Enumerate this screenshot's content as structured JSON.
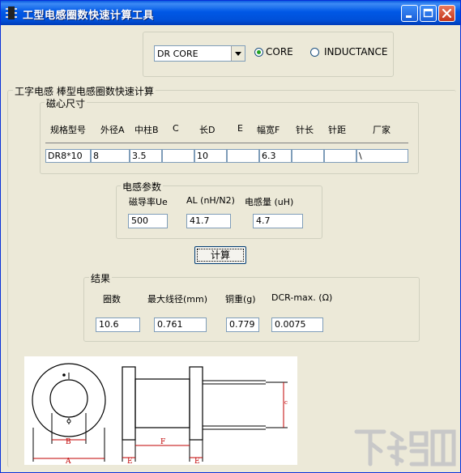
{
  "window": {
    "title": "工型电感圈数快速计算工具"
  },
  "mode": {
    "core_select_value": "DR CORE",
    "radio_core": "CORE",
    "radio_inductance": "INDUCTANCE"
  },
  "main_group": {
    "label": "工字电感 棒型电感圈数快速计算"
  },
  "core_size": {
    "label": "磁心尺寸",
    "headers": [
      "规格型号",
      "外径A",
      "中柱B",
      "C",
      "长D",
      "E",
      "幅宽F",
      "针长",
      "针距",
      "厂家"
    ],
    "values": [
      "DR8*10",
      "8",
      "3.5",
      "",
      "10",
      "",
      "6.3",
      "",
      "",
      "\\"
    ]
  },
  "inductance_params": {
    "label": "电感参数",
    "permeability_label": "磁导率Ue",
    "permeability_value": "500",
    "al_label": "AL (nH/N2)",
    "al_value": "41.7",
    "inductance_label": "电感量 (uH)",
    "inductance_value": "4.7"
  },
  "calc_button": {
    "label": "计算"
  },
  "results": {
    "label": "结果",
    "turns_label": "圈数",
    "turns_value": "10.6",
    "max_wire_label": "最大线径(mm)",
    "max_wire_value": "0.761",
    "copper_weight_label": "铜重(g)",
    "copper_weight_value": "0.779",
    "dcr_label": "DCR-max. (Ω)",
    "dcr_value": "0.0075"
  },
  "diagram": {
    "label_b": "B",
    "label_a": "A",
    "label_e1": "E",
    "label_f": "F",
    "label_e2": "E",
    "label_c": "c"
  },
  "colors": {
    "titlebar": "#0058E6",
    "face": "#ECE9D8",
    "input_border": "#7F9DB9",
    "diagram_red": "#C00000"
  }
}
